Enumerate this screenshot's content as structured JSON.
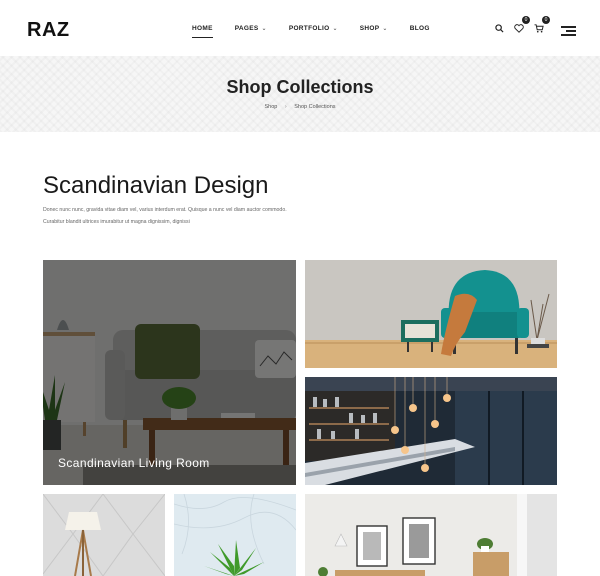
{
  "header": {
    "logo": "RAZ",
    "nav": [
      {
        "label": "HOME",
        "active": true,
        "has_dropdown": false
      },
      {
        "label": "PAGES",
        "active": false,
        "has_dropdown": true
      },
      {
        "label": "PORTFOLIO",
        "active": false,
        "has_dropdown": true
      },
      {
        "label": "SHOP",
        "active": false,
        "has_dropdown": true
      },
      {
        "label": "BLOG",
        "active": false,
        "has_dropdown": false
      }
    ],
    "wishlist_count": "0",
    "cart_count": "0"
  },
  "banner": {
    "title": "Shop Collections",
    "breadcrumb": [
      "Shop",
      "Shop Collections"
    ]
  },
  "collection": {
    "title": "Scandinavian Design",
    "description_lines": [
      "Donec nunc nunc, gravida vitae diam vel, varius interdum erat. Quisque a nunc vel diam auctor commodo.",
      "Curabitur blandit ultrices imurabitur ut magna dignissim, dignissi"
    ]
  },
  "tiles": [
    {
      "label": "Scandinavian Living Room"
    }
  ],
  "colors": {
    "accent_dark": "#222222",
    "chair_teal": "#13918f",
    "banner_bg": "#f6f6f6"
  }
}
